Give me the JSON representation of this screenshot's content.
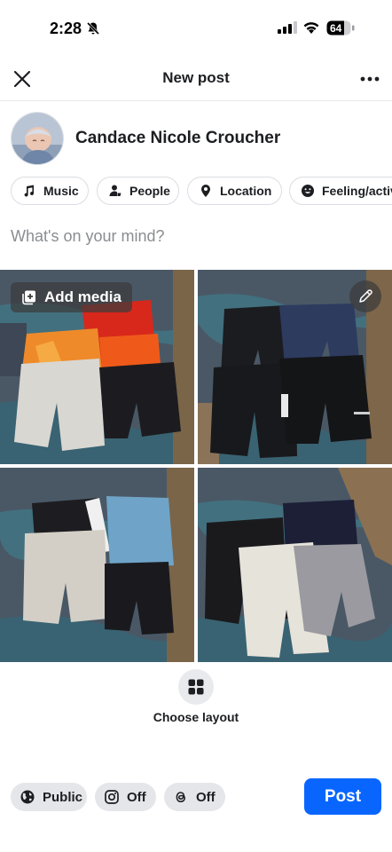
{
  "status_bar": {
    "time": "2:28",
    "battery_level": "64"
  },
  "header": {
    "title": "New post"
  },
  "user": {
    "name": "Candace Nicole Croucher"
  },
  "chips": [
    {
      "label": "Music",
      "icon": "music-note-icon"
    },
    {
      "label": "People",
      "icon": "person-tag-icon"
    },
    {
      "label": "Location",
      "icon": "location-pin-icon"
    },
    {
      "label": "Feeling/activity",
      "icon": "smiley-icon"
    }
  ],
  "composer": {
    "placeholder": "What's on your mind?"
  },
  "media": {
    "add_label": "Add media",
    "photo_count": 4
  },
  "layout": {
    "label": "Choose layout"
  },
  "footer": {
    "audience_label": "Public",
    "instagram_label": "Off",
    "threads_label": "Off",
    "post_label": "Post"
  },
  "colors": {
    "accent": "#0866ff",
    "chip_border": "#dadde1",
    "pill_bg": "#e4e6ea",
    "placeholder": "#8a8d91"
  }
}
